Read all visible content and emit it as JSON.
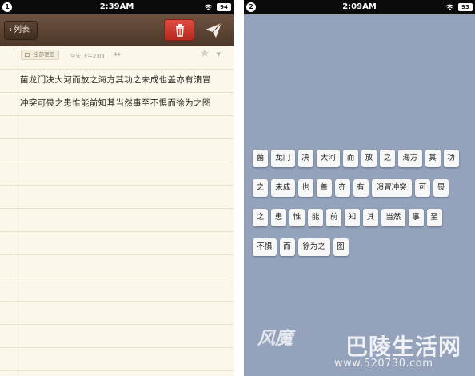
{
  "left_screen": {
    "status": {
      "notification_count": "1",
      "time": "2:39AM",
      "battery": "94"
    },
    "nav": {
      "back_label": "列表",
      "delete_icon": "trash-icon",
      "send_icon": "paper-plane-icon"
    },
    "note": {
      "tag": "全部便签",
      "timestamp": "今天 上午2:08",
      "char_count": "44",
      "lines": [
        "菌龙门决大河而放之海方其功之未成也盖亦有溃冒",
        "冲突可畏之患惟能前知其当然事至不惧而徐为之图"
      ]
    }
  },
  "right_screen": {
    "status": {
      "notification_count": "2",
      "time": "2:09AM",
      "battery": "93"
    },
    "tile_rows": [
      [
        "菌",
        "龙门",
        "决",
        "大河",
        "而",
        "放",
        "之",
        "海方",
        "其",
        "功"
      ],
      [
        "之",
        "未成",
        "也",
        "盖",
        "亦",
        "有",
        "溃冒冲突",
        "可",
        "畏"
      ],
      [
        "之",
        "患",
        "惟",
        "能",
        "前",
        "知",
        "其",
        "当然",
        "事",
        "至"
      ],
      [
        "不惧",
        "而",
        "徐为之",
        "图"
      ]
    ]
  },
  "watermark": {
    "left_text": "风魔",
    "brand": "巴陵生活网",
    "url": "www.520730.com"
  }
}
